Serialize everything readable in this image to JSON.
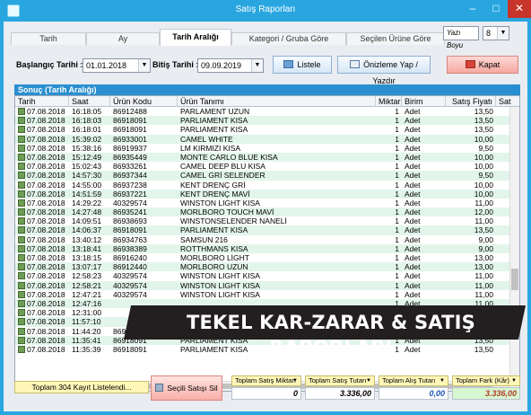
{
  "window": {
    "title": "Satış Raporları"
  },
  "tabs": [
    {
      "label": "Tarih"
    },
    {
      "label": "Ay"
    },
    {
      "label": "Tarih Aralığı"
    },
    {
      "label": "Kategori / Gruba Göre"
    },
    {
      "label": "Seçilen Ürüne Göre"
    }
  ],
  "font_size": {
    "label": "Yazı Boyu",
    "value": "8"
  },
  "filters": {
    "start_label": "Başlangıç Tarihi :",
    "start_value": "01.01.2018",
    "end_label": "Bitiş Tarihi :",
    "end_value": "09.09.2019"
  },
  "buttons": {
    "list": "Listele",
    "preview": "Önizleme Yap / Yazdır",
    "close": "Kapat",
    "delete_selected": "Seçili Satışı Sil"
  },
  "result": {
    "title": "Sonuç (Tarih Aralığı)"
  },
  "table": {
    "columns": [
      "Tarih",
      "Saat",
      "Ürün Kodu",
      "Ürün Tanımı",
      "Miktar",
      "Birim",
      "Satış Fiyatı",
      "Sat"
    ],
    "rows": [
      [
        "07.08.2018",
        "16:18:05",
        "86912488",
        "PARLAMENT UZUN",
        "1",
        "Adet",
        "13,50"
      ],
      [
        "07.08.2018",
        "16:18:03",
        "86918091",
        "PARLIAMENT KISA",
        "1",
        "Adet",
        "13,50"
      ],
      [
        "07.08.2018",
        "16:18:01",
        "86918091",
        "PARLIAMENT KISA",
        "1",
        "Adet",
        "13,50"
      ],
      [
        "07.08.2018",
        "15:39:02",
        "86933001",
        "CAMEL WHITE",
        "1",
        "Adet",
        "10,00"
      ],
      [
        "07.08.2018",
        "15:38:16",
        "86919937",
        "LM KIRMIZI KISA",
        "1",
        "Adet",
        "9,50"
      ],
      [
        "07.08.2018",
        "15:12:49",
        "86935449",
        "MONTE CARLO BLUE KISA",
        "1",
        "Adet",
        "10,00"
      ],
      [
        "07.08.2018",
        "15:02:43",
        "86933261",
        "CAMEL DEEP BLU KISA",
        "1",
        "Adet",
        "10,00"
      ],
      [
        "07.08.2018",
        "14:57:30",
        "86937344",
        "CAMEL GRİ SELENDER",
        "1",
        "Adet",
        "9,50"
      ],
      [
        "07.08.2018",
        "14:55:00",
        "86937238",
        "KENT DRENÇ GRİ",
        "1",
        "Adet",
        "10,00"
      ],
      [
        "07.08.2018",
        "14:51:59",
        "86937221",
        "KENT DRENÇ MAVİ",
        "1",
        "Adet",
        "10,00"
      ],
      [
        "07.08.2018",
        "14:29:22",
        "40329574",
        "WINSTON LIGHT KISA",
        "1",
        "Adet",
        "11,00"
      ],
      [
        "07.08.2018",
        "14:27:48",
        "86935241",
        "MORLBORO TOUCH MAVİ",
        "1",
        "Adet",
        "12,00"
      ],
      [
        "07.08.2018",
        "14:09:51",
        "86938693",
        "WINSTONSELENDER NANELİ",
        "1",
        "Adet",
        "11,00"
      ],
      [
        "07.08.2018",
        "14:06:37",
        "86918091",
        "PARLIAMENT KISA",
        "1",
        "Adet",
        "13,50"
      ],
      [
        "07.08.2018",
        "13:40:12",
        "86934763",
        "SAMSUN 216",
        "1",
        "Adet",
        "9,00"
      ],
      [
        "07.08.2018",
        "13:18:41",
        "86938389",
        "ROTTHMANS KISA",
        "1",
        "Adet",
        "9,00"
      ],
      [
        "07.08.2018",
        "13:18:15",
        "86916240",
        "MORLBORO LİGHT",
        "1",
        "Adet",
        "13,00"
      ],
      [
        "07.08.2018",
        "13:07:17",
        "86912440",
        "MORLBORO UZUN",
        "1",
        "Adet",
        "13,00"
      ],
      [
        "07.08.2018",
        "12:58:23",
        "40329574",
        "WINSTON LIGHT KISA",
        "1",
        "Adet",
        "11,00"
      ],
      [
        "07.08.2018",
        "12:58:21",
        "40329574",
        "WINSTON LIGHT KISA",
        "1",
        "Adet",
        "11,00"
      ],
      [
        "07.08.2018",
        "12:47:21",
        "40329574",
        "WINSTON LIGHT KISA",
        "1",
        "Adet",
        "11,00"
      ],
      [
        "07.08.2018",
        "12:47:16",
        "",
        "",
        "1",
        "Adet",
        "11,00"
      ],
      [
        "07.08.2018",
        "12:31:00",
        "",
        "",
        "1",
        "Adet",
        "11,00"
      ],
      [
        "07.08.2018",
        "11:57:10",
        "",
        "",
        "1",
        "Adet",
        "13,50"
      ],
      [
        "07.08.2018",
        "11:44:20",
        "8698562423713",
        "HD SLİM",
        "1",
        "Adet",
        "8,50"
      ],
      [
        "07.08.2018",
        "11:35:41",
        "86918091",
        "PARLIAMENT KISA",
        "1",
        "Adet",
        "13,50"
      ],
      [
        "07.08.2018",
        "11:35:39",
        "86918091",
        "PARLIAMENT KISA",
        "1",
        "Adet",
        "13,50"
      ]
    ]
  },
  "banner": {
    "text": "TEKEL KAR-ZARAR & SATIŞ RAPORLARI"
  },
  "footer": {
    "count_text": "Toplam 304 Kayıt Listelendi...",
    "totals": [
      {
        "label": "Toplam Satış Miktarı",
        "value": "0"
      },
      {
        "label": "Toplam Satış Tutarı",
        "value": "3.336,00"
      },
      {
        "label": "Toplam Alış Tutarı",
        "value": "0,00"
      },
      {
        "label": "Toplam Fark (Kâr)",
        "value": "3.336,00"
      }
    ]
  }
}
